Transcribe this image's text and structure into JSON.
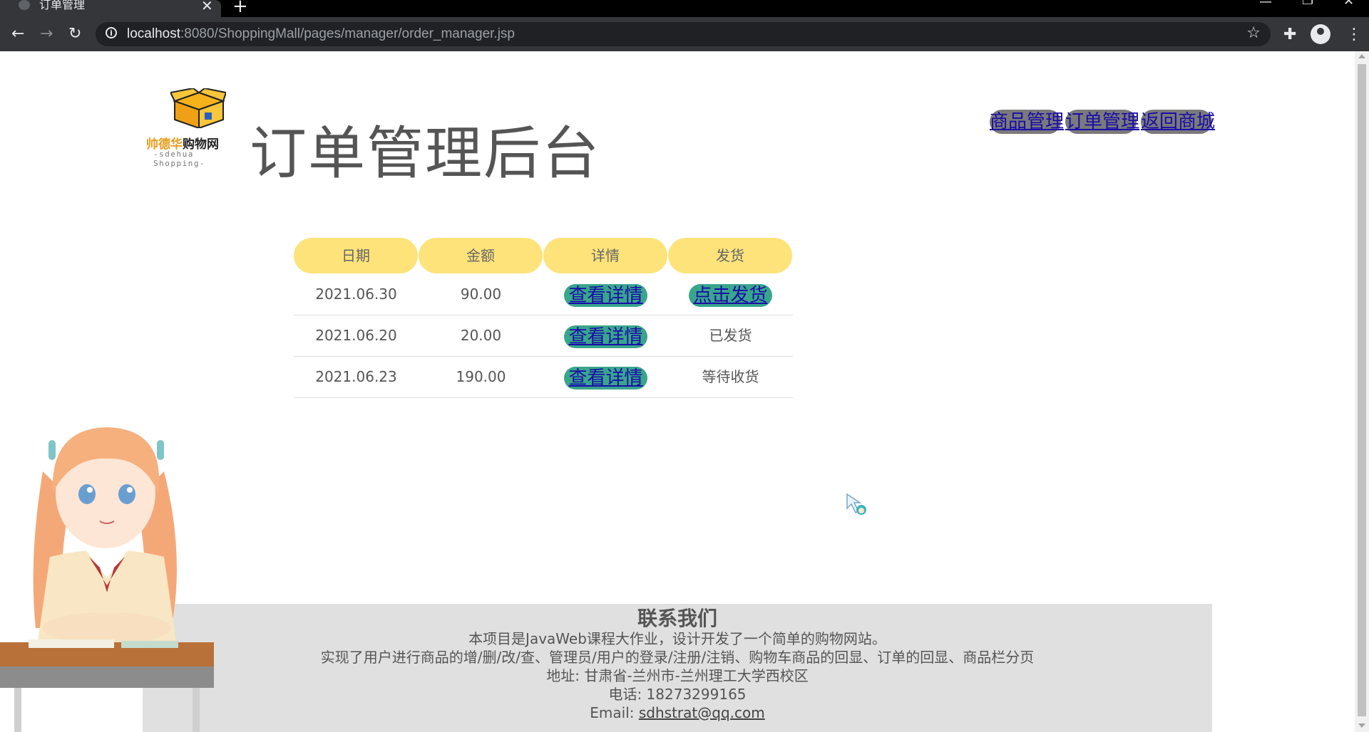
{
  "browser": {
    "tab_title": "订单管理",
    "url_host": "localhost",
    "url_rest": ":8080/ShoppingMall/pages/manager/order_manager.jsp"
  },
  "header": {
    "title": "订单管理后台",
    "logo_brand": "帅德华",
    "logo_brand_suffix": "购物网",
    "logo_sub": "-sdehua Shopping-"
  },
  "nav": {
    "items": [
      "商品管理",
      "订单管理",
      "返回商城"
    ]
  },
  "orders": {
    "columns": [
      "日期",
      "金额",
      "详情",
      "发货"
    ],
    "rows": [
      {
        "date": "2021.06.30",
        "amount": "90.00",
        "detail": "查看详情",
        "ship": "点击发货",
        "ship_is_link": true
      },
      {
        "date": "2021.06.20",
        "amount": "20.00",
        "detail": "查看详情",
        "ship": "已发货",
        "ship_is_link": false
      },
      {
        "date": "2021.06.23",
        "amount": "190.00",
        "detail": "查看详情",
        "ship": "等待收货",
        "ship_is_link": false
      }
    ]
  },
  "footer": {
    "title": "联系我们",
    "line1": "本项目是JavaWeb课程大作业，设计开发了一个简单的购物网站。",
    "line2": "实现了用户进行商品的增/删/改/查、管理员/用户的登录/注册/注销、购物车商品的回显、订单的回显、商品栏分页",
    "line3": "地址: 甘肃省-兰州市-兰州理工大学西校区",
    "line4": "电话: 18273299165",
    "email_label": "Email: ",
    "email": "sdhstrat@qq.com"
  },
  "colors": {
    "header_pill": "#fde37a",
    "action_pill": "#39a58b",
    "nav_pill": "#7a7a7a",
    "footer_bg": "#e0e0e0"
  }
}
